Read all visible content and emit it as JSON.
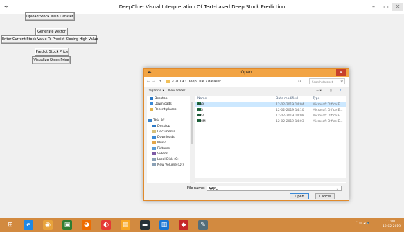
{
  "window": {
    "title": "DeepClue: Visual Interpretation Of Text-based Deep Stock Prediction",
    "icon": "feather-icon",
    "minimize": "–",
    "maximize": "▭",
    "close": "✕"
  },
  "controls": {
    "upload": "Upload Stock Train Dataset",
    "generate": "Generate Vector",
    "current_value_label": "Enter Current Stock Value To Predict Closing High Value",
    "predict": "Predict Stock Price",
    "visualize": "Visualize Stock Price"
  },
  "dialog": {
    "title": "Open",
    "close": "✕",
    "back": "←",
    "forward": "→",
    "up": "↑",
    "path": "« 2019 › DeepClue › dataset",
    "refresh": "↻",
    "search_placeholder": "Search dataset",
    "organize": "Organize ▾",
    "new_folder": "New folder",
    "nav_items": [
      {
        "label": "Desktop",
        "icon": "desktop-icon"
      },
      {
        "label": "Downloads",
        "icon": "downloads-icon"
      },
      {
        "label": "Recent places",
        "icon": "recent-places-icon"
      },
      {
        "label": "This PC",
        "icon": "computer-icon"
      },
      {
        "label": "Desktop",
        "icon": "desktop-icon"
      },
      {
        "label": "Documents",
        "icon": "documents-icon"
      },
      {
        "label": "Downloads",
        "icon": "downloads-icon"
      },
      {
        "label": "Music",
        "icon": "music-icon"
      },
      {
        "label": "Pictures",
        "icon": "pictures-icon"
      },
      {
        "label": "Videos",
        "icon": "videos-icon"
      },
      {
        "label": "Local Disk (C:)",
        "icon": "disk-icon"
      },
      {
        "label": "New Volume (D:)",
        "icon": "disk-icon"
      }
    ],
    "columns": {
      "name": "Name",
      "date": "Date modified",
      "type": "Type"
    },
    "files": [
      {
        "name": "AAPL",
        "date": "12-02-2019 14:04",
        "type": "Microsoft Office E...",
        "selected": true
      },
      {
        "name": "AIG",
        "date": "12-02-2019 14:10",
        "type": "Microsoft Office E...",
        "selected": false
      },
      {
        "name": "AXP",
        "date": "12-02-2019 14:09",
        "type": "Microsoft Office E...",
        "selected": false
      },
      {
        "name": "MMM",
        "date": "12-02-2019 14:03",
        "type": "Microsoft Office E...",
        "selected": false
      }
    ],
    "file_name_label": "File name:",
    "file_name_value": "AAPL",
    "open": "Open",
    "cancel": "Cancel"
  },
  "taskbar": {
    "icons": [
      {
        "name": "start-icon",
        "glyph": "⊞",
        "color": "#1565c0"
      },
      {
        "name": "internet-explorer-icon",
        "glyph": "e",
        "color": "#1e88e5"
      },
      {
        "name": "chrome-icon",
        "glyph": "◉",
        "color": "#e8a33c"
      },
      {
        "name": "excel-icon",
        "glyph": "▣",
        "color": "#2e7d32"
      },
      {
        "name": "firefox-icon",
        "glyph": "◕",
        "color": "#ef6c00"
      },
      {
        "name": "media-icon",
        "glyph": "◐",
        "color": "#e53935"
      },
      {
        "name": "file-explorer-icon",
        "glyph": "▤",
        "color": "#f9a825"
      },
      {
        "name": "terminal-icon",
        "glyph": "▬",
        "color": "#263238"
      },
      {
        "name": "python-idle-icon",
        "glyph": "▥",
        "color": "#1976d2"
      },
      {
        "name": "app-icon",
        "glyph": "◆",
        "color": "#c62828"
      },
      {
        "name": "feather-app-icon",
        "glyph": "✎",
        "color": "#546e7a"
      }
    ],
    "time": "11:00",
    "date": "12-02-2019"
  }
}
